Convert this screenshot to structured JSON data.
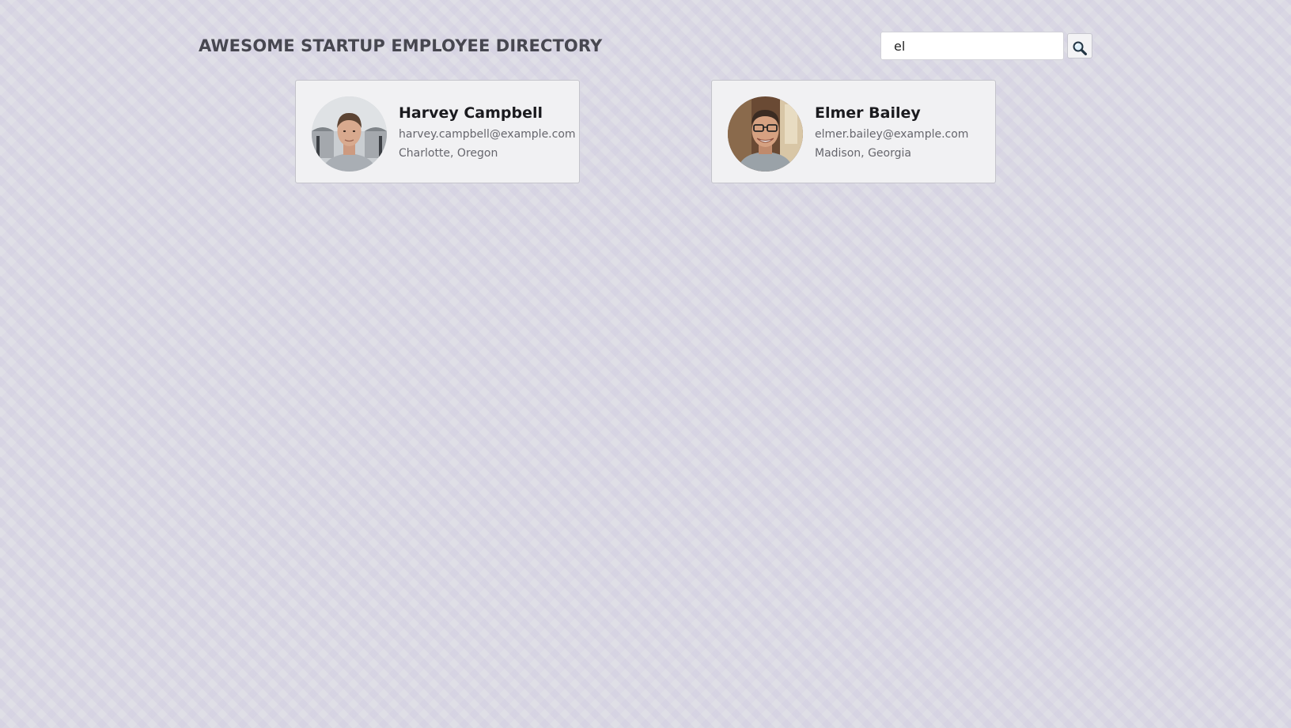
{
  "header": {
    "title": "AWESOME STARTUP EMPLOYEE DIRECTORY"
  },
  "search": {
    "value": "el",
    "button_icon": "search-icon"
  },
  "employees": [
    {
      "name": "Harvey Campbell",
      "email": "harvey.campbell@example.com",
      "location": "Charlotte, Oregon"
    },
    {
      "name": "Elmer Bailey",
      "email": "elmer.bailey@example.com",
      "location": "Madison, Georgia"
    }
  ]
}
